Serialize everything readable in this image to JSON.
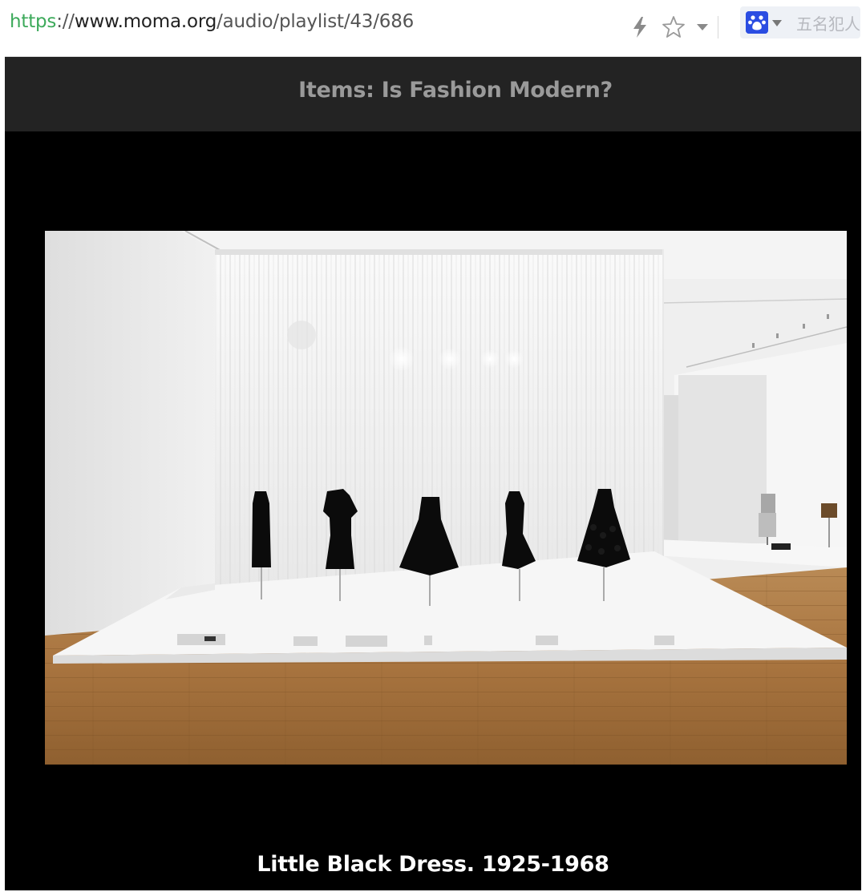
{
  "browser": {
    "url_scheme": "https",
    "url_sep": "://",
    "url_domain": "www.moma.org",
    "url_path": "/audio/playlist/43/686",
    "search_placeholder": "五名犯人",
    "icons": [
      "lightning-icon",
      "star-icon",
      "chevron-down-icon",
      "baidu-paw-icon"
    ]
  },
  "page": {
    "header_title": "Items: Is Fashion Modern?",
    "caption": "Little Black Dress. 1925-1968",
    "colors": {
      "header_bg": "#232323",
      "page_bg": "#000000",
      "header_text": "#9a9a9a",
      "caption_text": "#ffffff"
    }
  }
}
